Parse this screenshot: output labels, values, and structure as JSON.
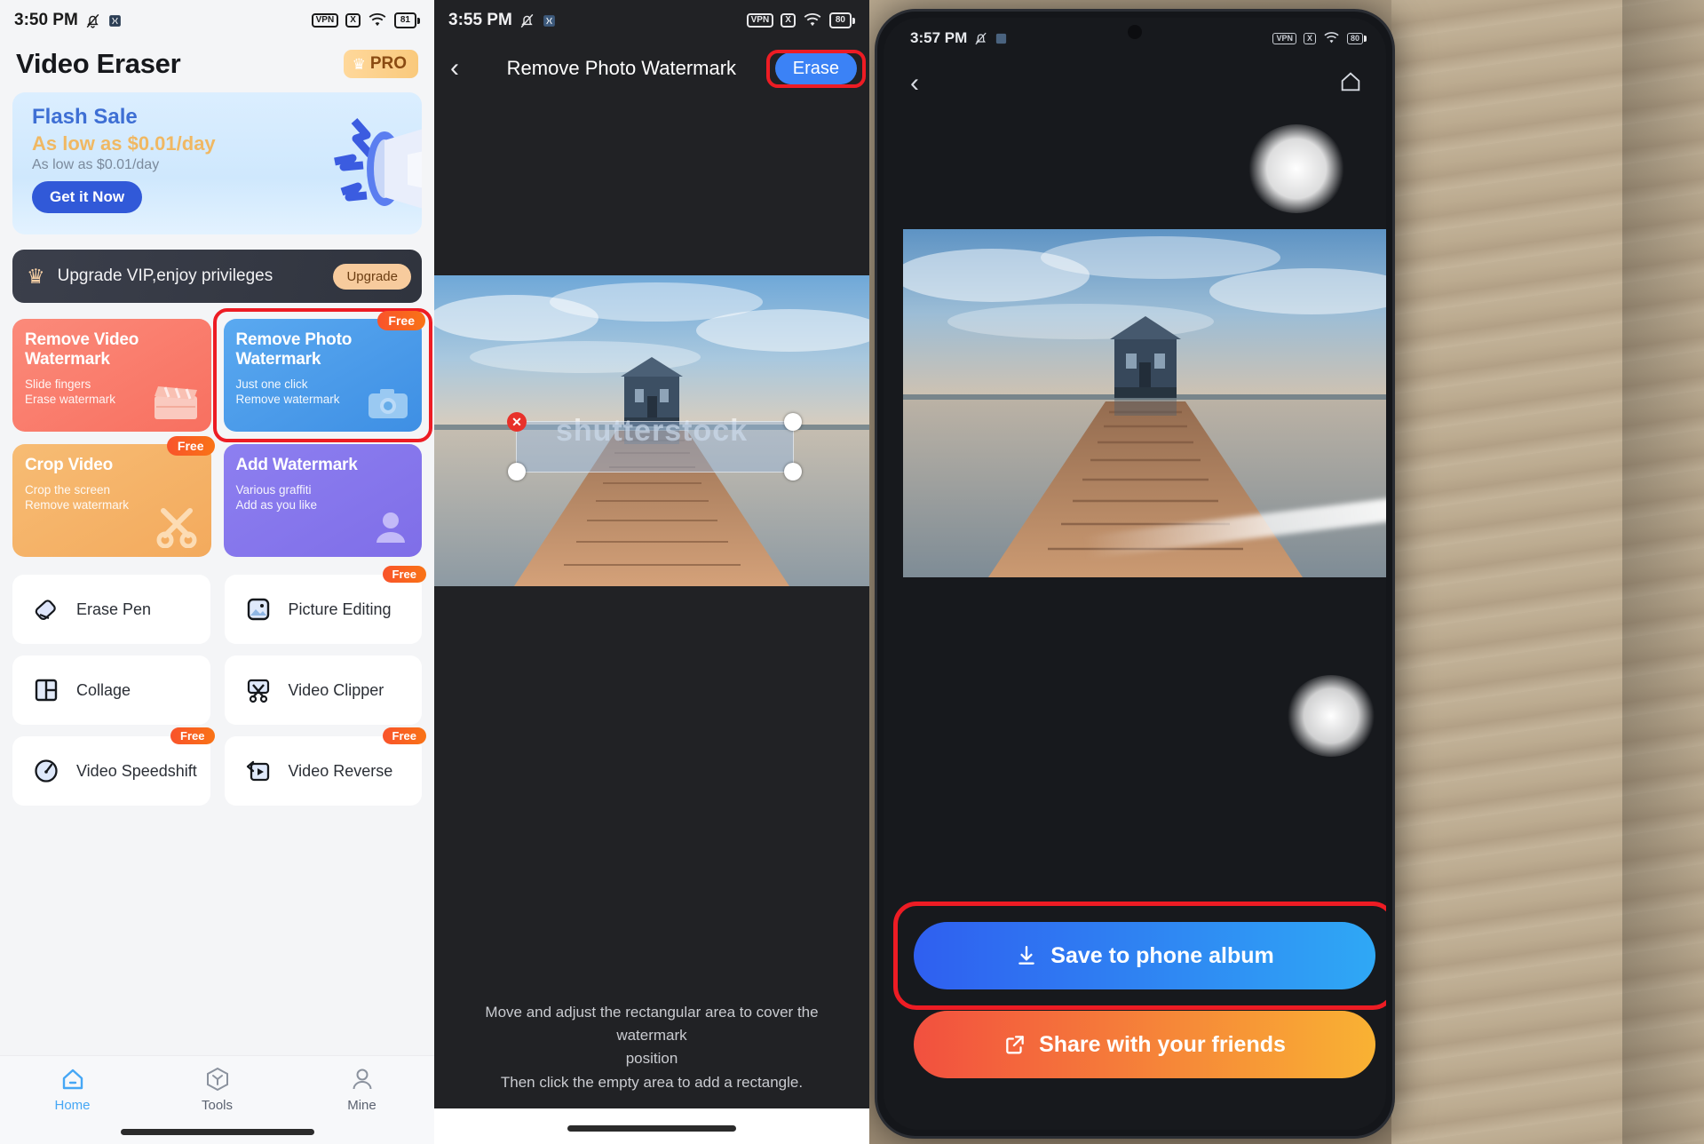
{
  "panel1": {
    "status": {
      "time": "3:50 PM",
      "icons": [
        "mute-icon",
        "app-icon"
      ],
      "vpn": "VPN",
      "x_badge": "X",
      "wifi": "wifi-icon",
      "battery": "81"
    },
    "app_title": "Video Eraser",
    "pro_badge": "PRO",
    "banner": {
      "title": "Flash Sale",
      "subtitle": "As low as $0.01/day",
      "caption": "As low as $0.01/day",
      "button": "Get it Now"
    },
    "vip": {
      "text": "Upgrade VIP,enjoy privileges",
      "button": "Upgrade"
    },
    "cards": [
      {
        "title": "Remove Video Watermark",
        "line1": "Slide fingers",
        "line2": "Erase watermark",
        "tag": "",
        "icon": "clapperboard-icon"
      },
      {
        "title": "Remove Photo Watermark",
        "line1": "Just one click",
        "line2": "Remove watermark",
        "tag": "Free",
        "icon": "camera-icon"
      },
      {
        "title": "Crop Video",
        "line1": "Crop the screen",
        "line2": "Remove watermark",
        "tag": "Free",
        "icon": "scissors-icon"
      },
      {
        "title": "Add Watermark",
        "line1": "Various graffiti",
        "line2": "Add as you like",
        "tag": "",
        "icon": "stamp-icon"
      }
    ],
    "tools": [
      {
        "label": "Erase Pen",
        "tag": "",
        "icon": "eraser-icon"
      },
      {
        "label": "Picture Editing",
        "tag": "Free",
        "icon": "picture-icon"
      },
      {
        "label": "Collage",
        "tag": "",
        "icon": "collage-icon"
      },
      {
        "label": "Video Clipper",
        "tag": "",
        "icon": "clipper-icon"
      },
      {
        "label": "Video Speedshift",
        "tag": "Free",
        "icon": "speed-icon"
      },
      {
        "label": "Video Reverse",
        "tag": "Free",
        "icon": "reverse-icon"
      }
    ],
    "nav": [
      {
        "label": "Home",
        "icon": "home-icon",
        "active": true
      },
      {
        "label": "Tools",
        "icon": "tools-icon",
        "active": false
      },
      {
        "label": "Mine",
        "icon": "person-icon",
        "active": false
      }
    ]
  },
  "panel2": {
    "status": {
      "time": "3:55 PM",
      "vpn": "VPN",
      "x_badge": "X",
      "battery": "80"
    },
    "back_icon": "back-chevron-icon",
    "title": "Remove Photo Watermark",
    "erase_button": "Erase",
    "watermark_text": "shutterstock",
    "hint_line1": "Move and adjust the rectangular area to cover the watermark",
    "hint_line2": "position",
    "hint_line3": "Then click the empty area to add a rectangle."
  },
  "panel3": {
    "status": {
      "time": "3:57 PM",
      "vpn": "VPN",
      "x_badge": "X",
      "battery": "80"
    },
    "back_icon": "back-chevron-icon",
    "home_icon": "home-icon",
    "save_button": "Save to phone album",
    "save_icon": "download-icon",
    "share_button": "Share with your friends",
    "share_icon": "share-icon"
  },
  "colors": {
    "accent_blue": "#3b82f6",
    "highlight_red": "#ed1c24",
    "free_orange": "#f9532b",
    "vip_gold": "#f7cb9d"
  }
}
